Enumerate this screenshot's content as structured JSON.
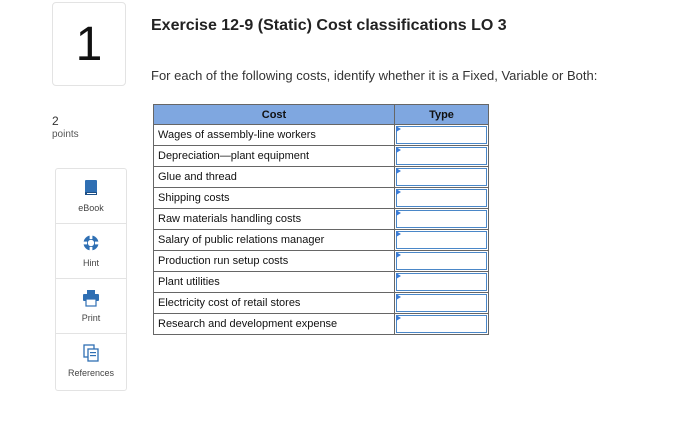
{
  "question": {
    "number": "1"
  },
  "points": {
    "value": "2",
    "label": "points"
  },
  "side_tools": [
    {
      "name": "ebook",
      "label": "eBook",
      "icon": "book-icon"
    },
    {
      "name": "hint",
      "label": "Hint",
      "icon": "lifebuoy-icon"
    },
    {
      "name": "print",
      "label": "Print",
      "icon": "printer-icon"
    },
    {
      "name": "references",
      "label": "References",
      "icon": "documents-icon"
    }
  ],
  "exercise": {
    "title": "Exercise 12-9 (Static) Cost classifications LO 3",
    "instruction": "For each of the following costs, identify whether it is a Fixed, Variable or Both:"
  },
  "table": {
    "headers": {
      "cost": "Cost",
      "type": "Type"
    },
    "rows": [
      {
        "cost": "Wages of assembly-line workers",
        "type": ""
      },
      {
        "cost": "Depreciation—plant equipment",
        "type": ""
      },
      {
        "cost": "Glue and thread",
        "type": ""
      },
      {
        "cost": "Shipping costs",
        "type": ""
      },
      {
        "cost": "Raw materials handling costs",
        "type": ""
      },
      {
        "cost": "Salary of public relations manager",
        "type": ""
      },
      {
        "cost": "Production run setup costs",
        "type": ""
      },
      {
        "cost": "Plant utilities",
        "type": ""
      },
      {
        "cost": "Electricity cost of retail stores",
        "type": ""
      },
      {
        "cost": "Research and development expense",
        "type": ""
      }
    ]
  },
  "colors": {
    "header_bg": "#7fa7e0",
    "dropdown_border": "#4a87c8",
    "icon_blue": "#2f6fb3"
  }
}
